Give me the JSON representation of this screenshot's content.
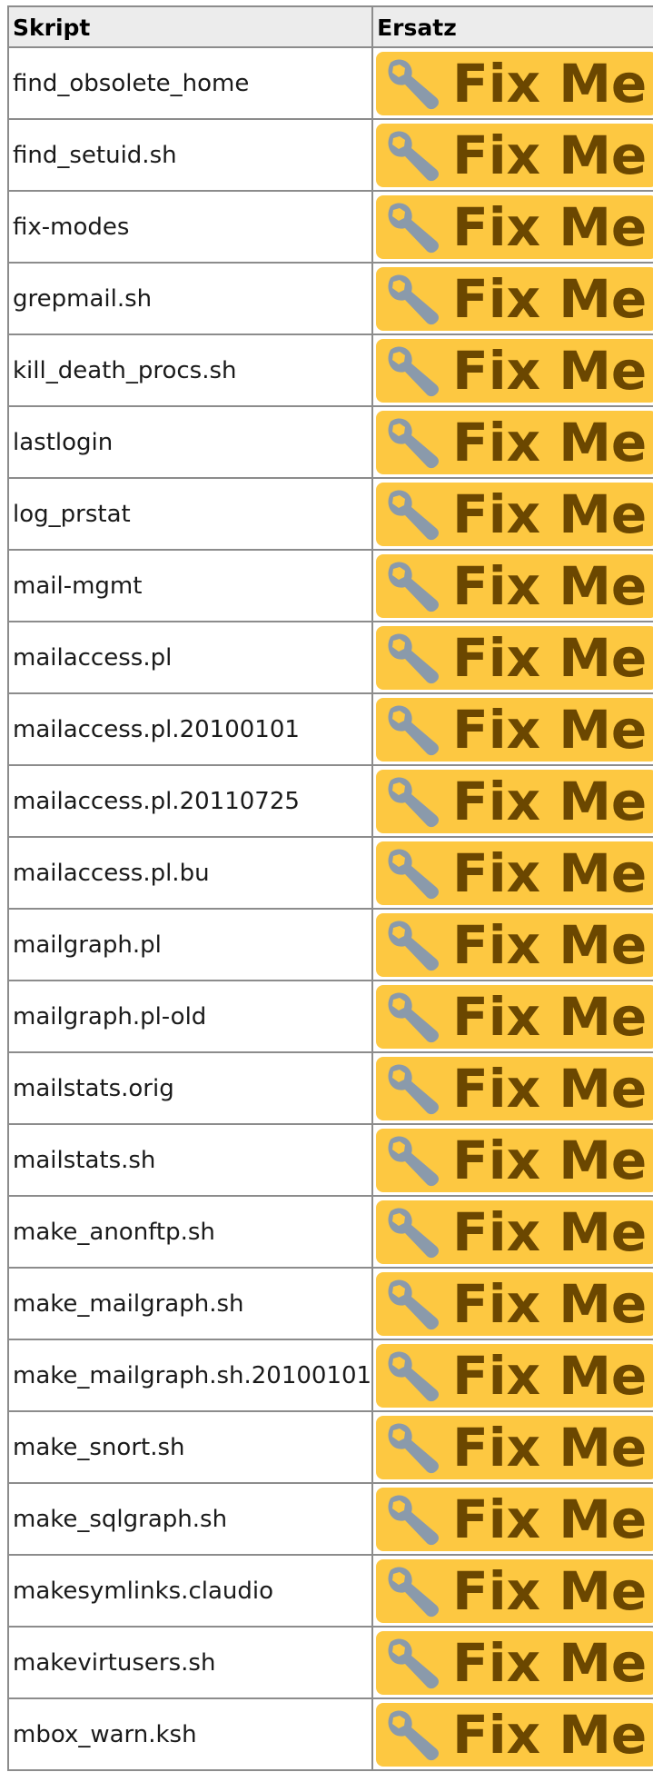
{
  "table": {
    "headers": {
      "script": "Skript",
      "replacement": "Ersatz"
    },
    "fixme_label": "Fix Me!",
    "fixme_icon": "wrench-icon",
    "colors": {
      "badge_bg": "#fdc841",
      "badge_text": "#6b4700",
      "wrench": "#8a9aab",
      "border": "#8c8c8c"
    },
    "rows": [
      {
        "script": "find_obsolete_home"
      },
      {
        "script": "find_setuid.sh"
      },
      {
        "script": "fix-modes"
      },
      {
        "script": "grepmail.sh"
      },
      {
        "script": "kill_death_procs.sh"
      },
      {
        "script": "lastlogin"
      },
      {
        "script": "log_prstat"
      },
      {
        "script": "mail-mgmt"
      },
      {
        "script": "mailaccess.pl"
      },
      {
        "script": "mailaccess.pl.20100101"
      },
      {
        "script": "mailaccess.pl.20110725"
      },
      {
        "script": "mailaccess.pl.bu"
      },
      {
        "script": "mailgraph.pl"
      },
      {
        "script": "mailgraph.pl-old"
      },
      {
        "script": "mailstats.orig"
      },
      {
        "script": "mailstats.sh"
      },
      {
        "script": "make_anonftp.sh"
      },
      {
        "script": "make_mailgraph.sh"
      },
      {
        "script": "make_mailgraph.sh.20100101"
      },
      {
        "script": "make_snort.sh"
      },
      {
        "script": "make_sqlgraph.sh"
      },
      {
        "script": "makesymlinks.claudio"
      },
      {
        "script": "makevirtusers.sh"
      },
      {
        "script": "mbox_warn.ksh"
      }
    ]
  }
}
